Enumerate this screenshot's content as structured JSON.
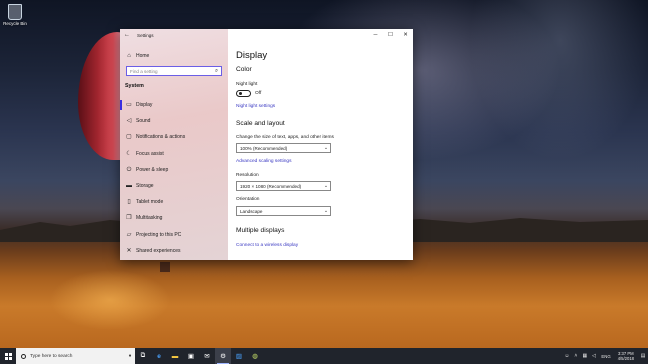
{
  "desktop": {
    "icons": [
      {
        "label": "Recycle Bin",
        "icon": "recycle-bin-icon"
      }
    ]
  },
  "settings_window": {
    "title": "Settings",
    "controls": {
      "minimize": "─",
      "maximize": "☐",
      "close": "✕"
    },
    "sidebar": {
      "home_label": "Home",
      "search_placeholder": "Find a setting",
      "section_label": "System",
      "items": [
        {
          "label": "Display",
          "icon": "display-icon",
          "glyph": "▭",
          "selected": true
        },
        {
          "label": "Sound",
          "icon": "sound-icon",
          "glyph": "◁"
        },
        {
          "label": "Notifications & actions",
          "icon": "notifications-icon",
          "glyph": "▢"
        },
        {
          "label": "Focus assist",
          "icon": "focus-assist-icon",
          "glyph": "☾"
        },
        {
          "label": "Power & sleep",
          "icon": "power-icon",
          "glyph": "⏻"
        },
        {
          "label": "Storage",
          "icon": "storage-icon",
          "glyph": "▬"
        },
        {
          "label": "Tablet mode",
          "icon": "tablet-icon",
          "glyph": "▯"
        },
        {
          "label": "Multitasking",
          "icon": "multitasking-icon",
          "glyph": "❐"
        },
        {
          "label": "Projecting to this PC",
          "icon": "projecting-icon",
          "glyph": "▱"
        },
        {
          "label": "Shared experiences",
          "icon": "shared-experiences-icon",
          "glyph": "✕"
        }
      ]
    },
    "content": {
      "page_title": "Display",
      "color_heading": "Color",
      "night_light_label": "Night light",
      "night_light_state": "Off",
      "night_light_link": "Night light settings",
      "scale_heading": "Scale and layout",
      "scale_label": "Change the size of text, apps, and other items",
      "scale_value": "100% (Recommended)",
      "advanced_scaling_link": "Advanced scaling settings",
      "resolution_label": "Resolution",
      "resolution_value": "1920 × 1080 (Recommended)",
      "orientation_label": "Orientation",
      "orientation_value": "Landscape",
      "multiple_displays_heading": "Multiple displays",
      "wireless_display_link": "Connect to a wireless display"
    }
  },
  "taskbar": {
    "search_placeholder": "Type here to search",
    "apps": [
      {
        "name": "task-view-icon",
        "glyph": "⧉"
      },
      {
        "name": "edge-icon",
        "glyph": "e"
      },
      {
        "name": "file-explorer-icon",
        "glyph": "▬"
      },
      {
        "name": "store-icon",
        "glyph": "▣"
      },
      {
        "name": "mail-icon",
        "glyph": "✉"
      },
      {
        "name": "settings-icon",
        "glyph": "⚙",
        "active": true
      },
      {
        "name": "photos-icon",
        "glyph": "▨"
      },
      {
        "name": "app-icon",
        "glyph": "◍"
      }
    ],
    "tray": {
      "language": "ENG",
      "time": "3:37 PM",
      "date": "4/5/2018"
    }
  }
}
